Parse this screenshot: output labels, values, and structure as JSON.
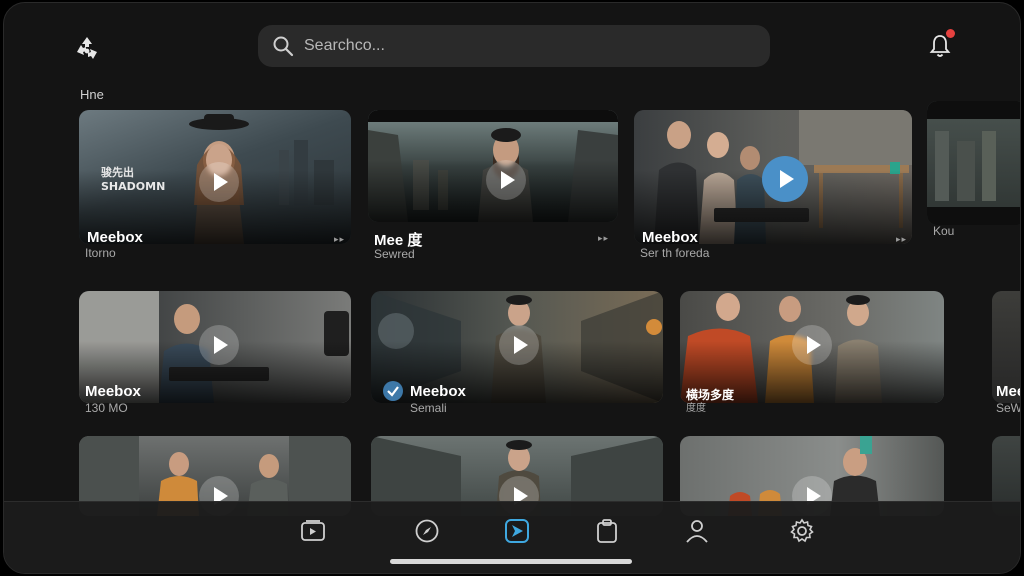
{
  "search": {
    "placeholder": "Searchco..."
  },
  "section": {
    "title": "Hne"
  },
  "cards": [
    {
      "title": "Meebox",
      "subtitle": "Itorno",
      "overlay": "骏先出\nSHADOMN",
      "more": "▸▸"
    },
    {
      "title": "Mee 度",
      "subtitle": "Sewred",
      "more": "▸▸"
    },
    {
      "title": "Meebox",
      "subtitle": "Ser th foreda",
      "more": "▸▸"
    },
    {
      "title": "",
      "subtitle": "Kou",
      "more": ""
    },
    {
      "title": "Meebox",
      "subtitle": "130 MO",
      "more": "▸▸"
    },
    {
      "title": "Meebox",
      "subtitle": "Semali",
      "more": ""
    },
    {
      "title": "横场多度",
      "subtitle": "度度",
      "more": ""
    },
    {
      "title": "Mee",
      "subtitle": "SeW",
      "more": ""
    }
  ],
  "nav": [
    "media-icon",
    "compass-icon",
    "send-icon",
    "clipboard-icon",
    "profile-icon",
    "settings-icon"
  ],
  "colors": {
    "accent": "#3fa8e0",
    "badge": "#e5413f",
    "background": "#141414"
  }
}
